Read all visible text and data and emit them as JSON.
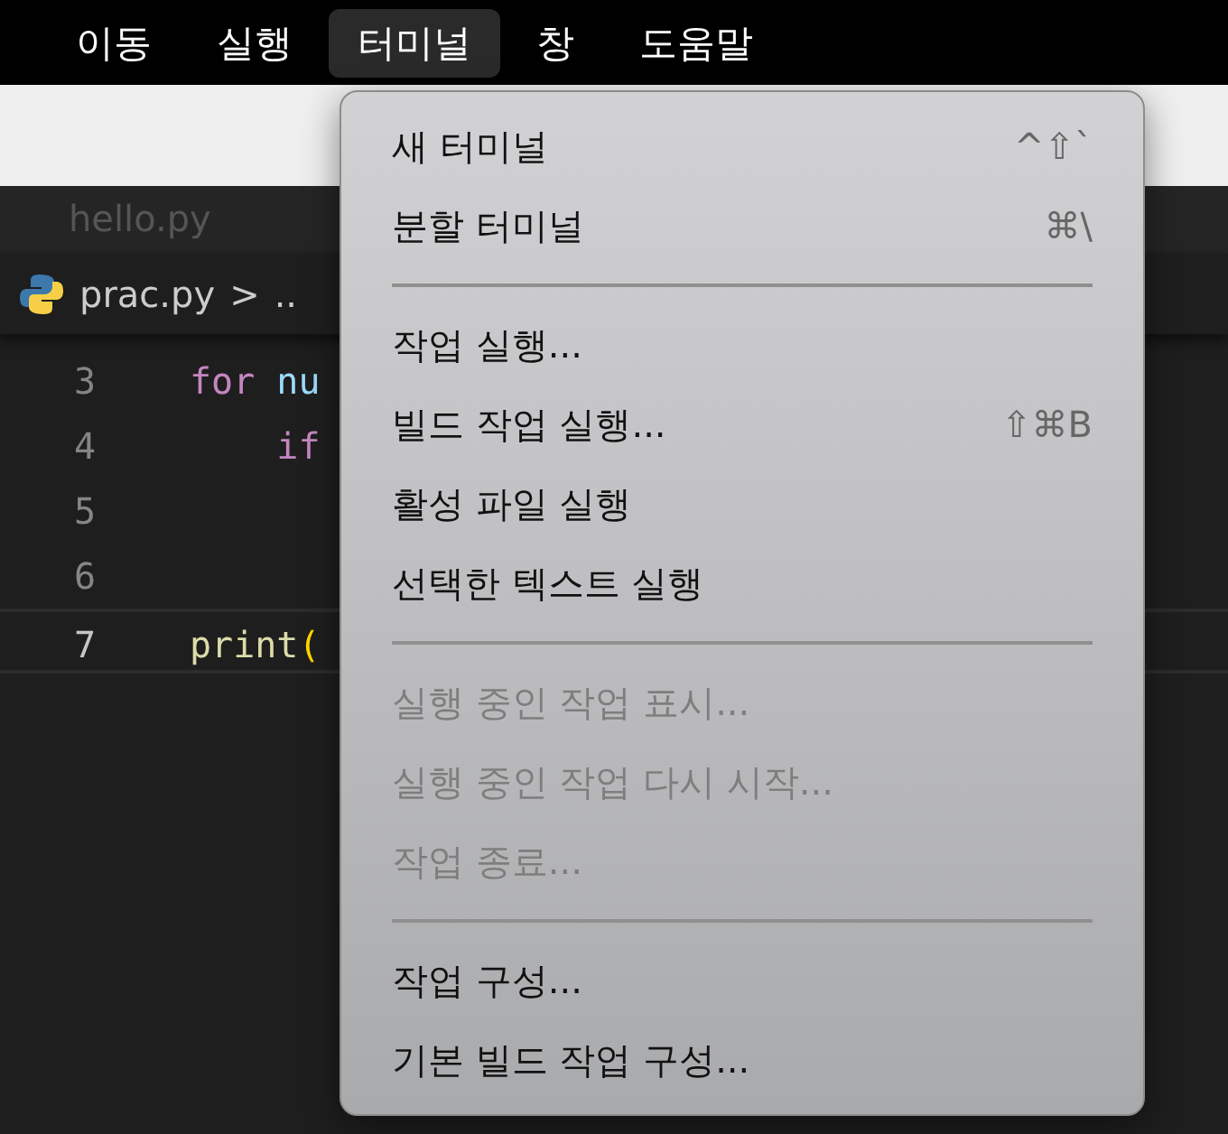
{
  "menu_bar": [
    {
      "label": "이동",
      "selected": false
    },
    {
      "label": "실행",
      "selected": false
    },
    {
      "label": "터미널",
      "selected": true
    },
    {
      "label": "창",
      "selected": false
    },
    {
      "label": "도움말",
      "selected": false
    }
  ],
  "tabs": [
    {
      "label": "hello.py",
      "selected": false
    }
  ],
  "breadcrumb": {
    "file": "prac.py",
    "separator": ">",
    "rest": ".."
  },
  "editor": {
    "lines": [
      {
        "number": "3",
        "current": false,
        "tokens": [
          {
            "text": "for",
            "kind": "keyword"
          },
          {
            "text": " nu",
            "kind": "variable"
          }
        ]
      },
      {
        "number": "4",
        "current": false,
        "tokens": [
          {
            "text": "    if",
            "kind": "keyword"
          }
        ]
      },
      {
        "number": "5",
        "current": false
      },
      {
        "number": "6",
        "current": false
      },
      {
        "number": "7",
        "current": true,
        "tokens": [
          {
            "text": "print",
            "kind": "function"
          },
          {
            "text": "(",
            "kind": "bracket"
          }
        ]
      }
    ]
  },
  "dropdown_menu": [
    {
      "kind": "item",
      "label": "새 터미널",
      "shortcut": "^⇧`",
      "disabled": false
    },
    {
      "kind": "item",
      "label": "분할 터미널",
      "shortcut": "⌘\\",
      "disabled": false
    },
    {
      "kind": "separator"
    },
    {
      "kind": "item",
      "label": "작업 실행...",
      "disabled": false
    },
    {
      "kind": "item",
      "label": "빌드 작업 실행...",
      "shortcut": "⇧⌘B",
      "disabled": false
    },
    {
      "kind": "item",
      "label": "활성 파일 실행",
      "disabled": false
    },
    {
      "kind": "item",
      "label": "선택한 텍스트 실행",
      "disabled": false
    },
    {
      "kind": "separator"
    },
    {
      "kind": "item",
      "label": "실행 중인 작업 표시...",
      "disabled": true
    },
    {
      "kind": "item",
      "label": "실행 중인 작업 다시 시작...",
      "disabled": true
    },
    {
      "kind": "item",
      "label": "작업 종료...",
      "disabled": true
    },
    {
      "kind": "separator"
    },
    {
      "kind": "item",
      "label": "작업 구성...",
      "disabled": false
    },
    {
      "kind": "item",
      "label": "기본 빌드 작업 구성...",
      "disabled": false
    }
  ]
}
